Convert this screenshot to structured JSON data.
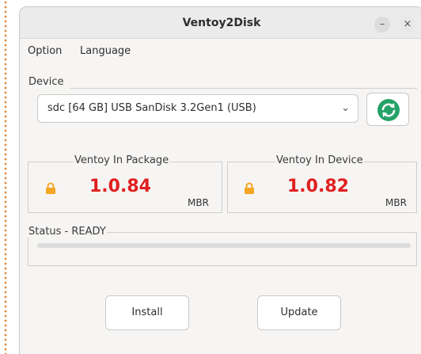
{
  "window": {
    "title": "Ventoy2Disk"
  },
  "titlebar": {
    "minimize_glyph": "–",
    "close_glyph": "×"
  },
  "menu": {
    "items": [
      "Option",
      "Language"
    ]
  },
  "device": {
    "group_label": "Device",
    "selected": "sdc  [64 GB]  USB  SanDisk 3.2Gen1 (USB)",
    "refresh_icon": "refresh-icon"
  },
  "package": {
    "label": "Ventoy In Package",
    "version": "1.0.84",
    "style": "MBR"
  },
  "installed": {
    "label": "Ventoy In Device",
    "version": "1.0.82",
    "style": "MBR"
  },
  "status": {
    "text": "Status - READY",
    "progress": 0
  },
  "actions": {
    "install": "Install",
    "update": "Update"
  },
  "colors": {
    "version": "#e02020",
    "lock": "#f5a623",
    "refresh": "#26a269"
  }
}
